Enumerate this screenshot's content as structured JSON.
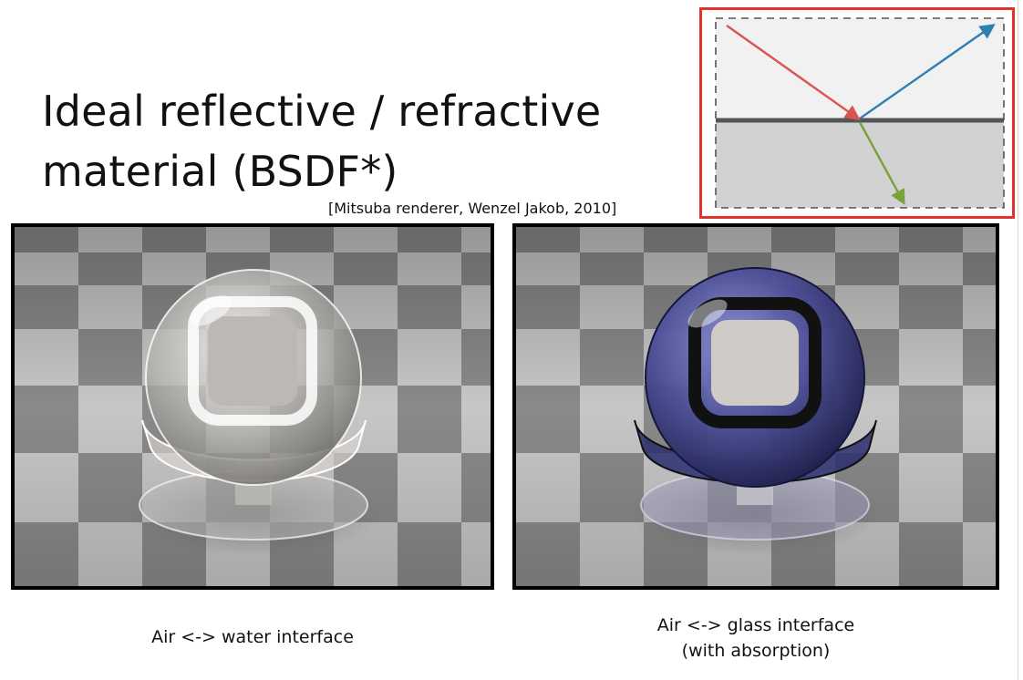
{
  "slide": {
    "title_lines": [
      "Ideal reflective / refractive",
      "material (BSDF*)"
    ],
    "credit": "[Mitsuba renderer, Wenzel Jakob, 2010]"
  },
  "diagram": {
    "frame_color": "#e0312b",
    "incident_color": "#d9534f",
    "reflected_color": "#2f7fb3",
    "refracted_color": "#7ba13a",
    "upper_medium_color": "#f1f1f2",
    "lower_medium_color": "#d2d2d3",
    "interface_color": "#555555"
  },
  "renders": [
    {
      "caption_lines": [
        "Air <-> water interface"
      ],
      "tint": "#c8c6c2",
      "rim": "#ffffff"
    },
    {
      "caption_lines": [
        "Air <-> glass interface",
        "(with absorption)"
      ],
      "tint": "#3d3f86",
      "rim": "#111111"
    }
  ],
  "checker": {
    "light": "#c7c7c7",
    "dark": "#8a8a8a"
  }
}
